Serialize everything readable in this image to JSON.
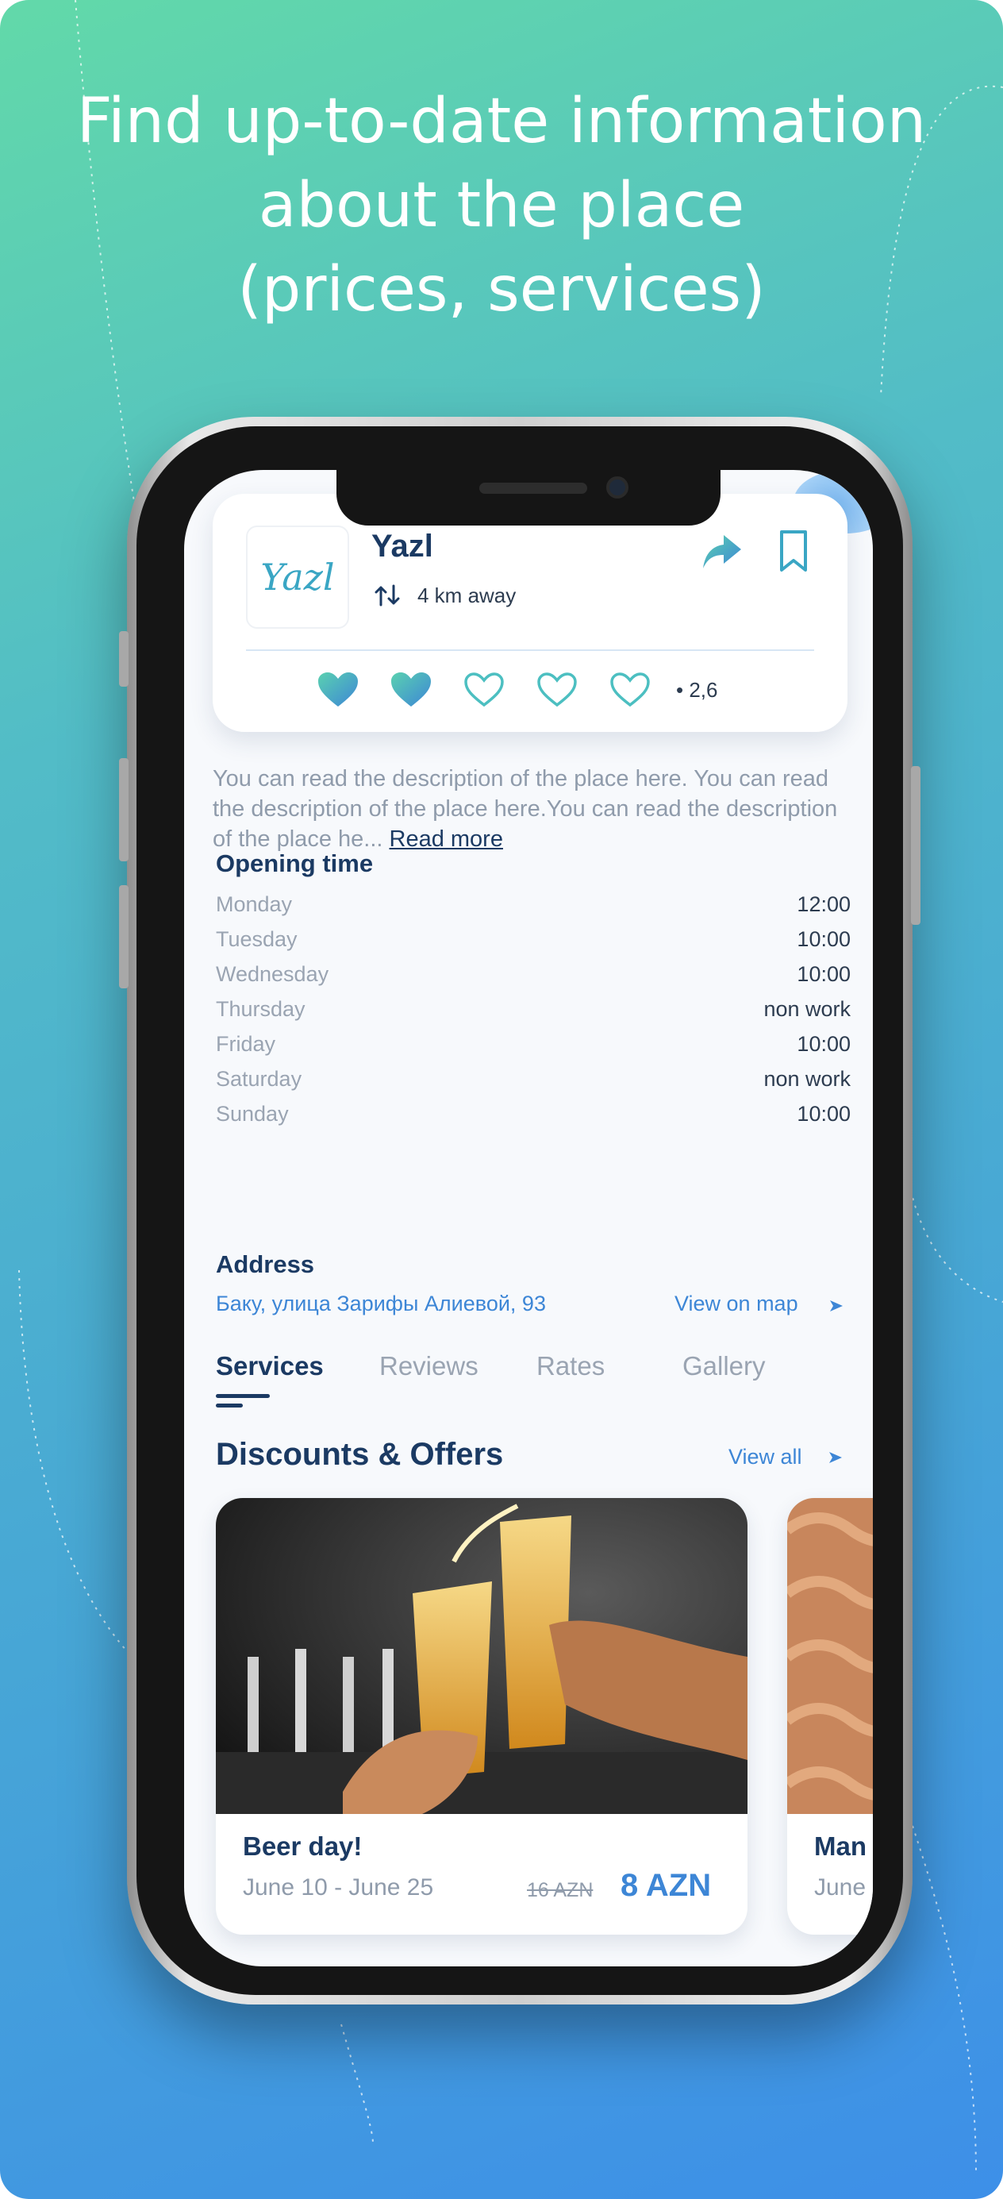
{
  "headline": {
    "line1": "Find up-to-date information",
    "line2": "about the place",
    "line3": "(prices, services)"
  },
  "place": {
    "logo_text": "Yazl",
    "name": "Yazl",
    "distance": "4 km away",
    "rating": {
      "filled": 2,
      "total": 5,
      "value": "• 2,6"
    },
    "icons": {
      "share": "share-icon",
      "bookmark": "bookmark-icon",
      "distance": "route-icon"
    }
  },
  "description": {
    "text": "You can read the description of the place here. You can read the description of the place here.You can read the description of the place he...",
    "read_more": "Read more"
  },
  "opening": {
    "title": "Opening time",
    "days": [
      {
        "day": "Monday",
        "time": "12:00"
      },
      {
        "day": "Tuesday",
        "time": "10:00"
      },
      {
        "day": "Wednesday",
        "time": "10:00"
      },
      {
        "day": "Thursday",
        "time": "non work"
      },
      {
        "day": "Friday",
        "time": "10:00"
      },
      {
        "day": "Saturday",
        "time": "non work"
      },
      {
        "day": "Sunday",
        "time": "10:00"
      }
    ]
  },
  "address": {
    "title": "Address",
    "value": "Баку, улица Зарифы Алиевой, 93",
    "map_link": "View on map"
  },
  "tabs": [
    "Services",
    "Reviews",
    "Rates",
    "Gallery"
  ],
  "offers": {
    "title": "Discounts & Offers",
    "view_all": "View all",
    "items": [
      {
        "title": "Beer day!",
        "dates": "June 10 - June 25",
        "old_price": "16 AZN",
        "new_price": "8 AZN"
      },
      {
        "title": "Man",
        "dates": "June"
      }
    ]
  },
  "colors": {
    "primary_dark": "#1b3a63",
    "accent_blue": "#3d86d6",
    "gradient_start": "#62d9a9",
    "gradient_end": "#3d8fe8"
  }
}
